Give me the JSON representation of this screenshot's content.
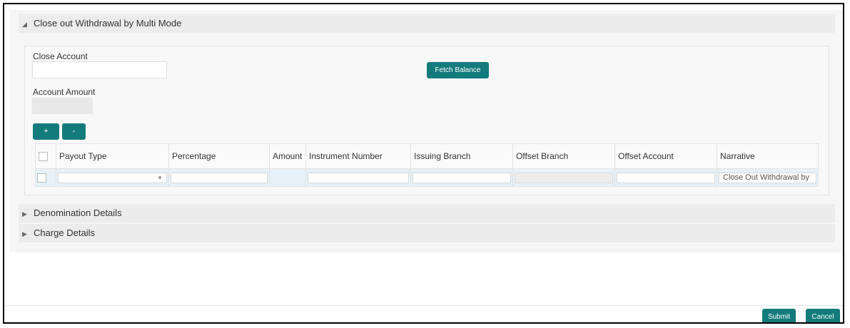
{
  "sections": {
    "main_title": "Close out Withdrawal by Multi Mode",
    "denomination_title": "Denomination Details",
    "charge_title": "Charge Details"
  },
  "form": {
    "close_account_label": "Close Account",
    "close_account_value": "",
    "account_amount_label": "Account Amount",
    "account_amount_value": "",
    "fetch_balance_label": "Fetch Balance",
    "add_row_label": "+",
    "remove_row_label": "-"
  },
  "grid": {
    "columns": [
      "Payout Type",
      "Percentage",
      "Amount",
      "Instrument Number",
      "Issuing Branch",
      "Offset Branch",
      "Offset Account",
      "Narrative"
    ],
    "rows": [
      {
        "payout_type": "",
        "percentage": "",
        "amount": "",
        "instrument_number": "",
        "issuing_branch": "",
        "offset_branch": "",
        "offset_account": "",
        "narrative": "Close Out Withdrawal by"
      }
    ]
  },
  "footer": {
    "submit_label": "Submit",
    "cancel_label": "Cancel"
  },
  "colors": {
    "accent": "#137b7b"
  },
  "icons": {
    "expanded": "triangle-down-icon",
    "collapsed": "triangle-right-icon",
    "dropdown": "chevron-down-icon"
  }
}
